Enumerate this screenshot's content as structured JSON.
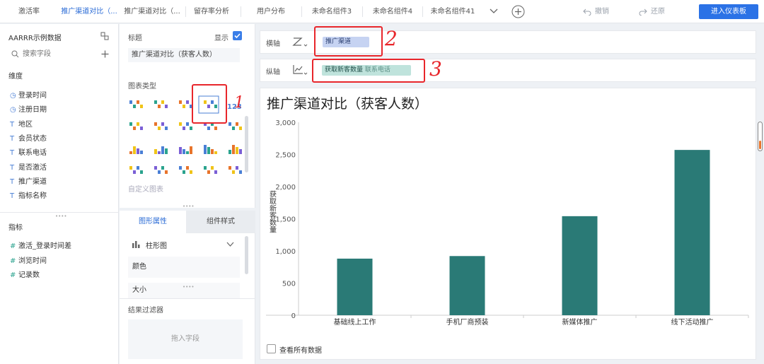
{
  "tabs": [
    {
      "label": "激活率"
    },
    {
      "label": "推广渠道对比（..."
    },
    {
      "label": "推广渠道对比（..."
    },
    {
      "label": "留存率分析"
    },
    {
      "label": "用户分布"
    },
    {
      "label": "未命名组件3"
    },
    {
      "label": "未命名组件4"
    },
    {
      "label": "未命名组件41"
    }
  ],
  "toolbar": {
    "undo": "撤销",
    "redo": "还原",
    "enter_dashboard": "进入仪表板"
  },
  "left": {
    "dataset": "AARRR示例数据",
    "search_placeholder": "搜索字段",
    "dim_title": "维度",
    "dimensions": [
      {
        "label": "登录时间",
        "icon": "clock-icon"
      },
      {
        "label": "注册日期",
        "icon": "clock-icon"
      },
      {
        "label": "地区",
        "icon": "text-type-icon"
      },
      {
        "label": "会员状态",
        "icon": "text-type-icon"
      },
      {
        "label": "联系电话",
        "icon": "text-type-icon"
      },
      {
        "label": "是否激活",
        "icon": "text-type-icon"
      },
      {
        "label": "推广渠道",
        "icon": "text-type-icon"
      },
      {
        "label": "指标名称",
        "icon": "text-type-icon"
      }
    ],
    "metric_title": "指标",
    "metrics": [
      {
        "label": "激活_登录时间差"
      },
      {
        "label": "浏览时间"
      },
      {
        "label": "记录数"
      }
    ]
  },
  "mid": {
    "title_label": "标题",
    "show_label": "显示",
    "title_value": "推广渠道对比（获客人数）",
    "chart_type_label": "图表类型",
    "custom_chart": "自定义图表",
    "tab_shape": "图形属性",
    "tab_style": "组件样式",
    "shape_select": "柱形图",
    "color_label": "颜色",
    "size_label": "大小",
    "filter_label": "结果过滤器",
    "drop_hint": "拖入字段"
  },
  "axes": {
    "x_label": "横轴",
    "x_field": "推广渠道",
    "y_label": "纵轴",
    "y_field": "获取新客数量",
    "y_field2": "联系电话"
  },
  "annotations": {
    "a1": "1",
    "a2": "2",
    "a3": "3"
  },
  "view_all": "查看所有数据",
  "colors": {
    "accent": "#2b72e6",
    "bar": "#2a7a76",
    "annotation": "#e8262b"
  },
  "chart_data": {
    "type": "bar",
    "title": "推广渠道对比（获客人数）",
    "ylabel": "获取新客数量",
    "xlabel": "",
    "categories": [
      "基础线上工作",
      "手机厂商预装",
      "新媒体推广",
      "线下活动推广"
    ],
    "values": [
      880,
      920,
      1540,
      2570
    ],
    "ylim": [
      0,
      3000
    ],
    "yticks": [
      0,
      500,
      1000,
      1500,
      2000,
      2500,
      3000
    ],
    "ytick_labels": [
      "0",
      "500",
      "1,000",
      "1,500",
      "2,000",
      "2,500",
      "3,000"
    ],
    "grid": false
  }
}
